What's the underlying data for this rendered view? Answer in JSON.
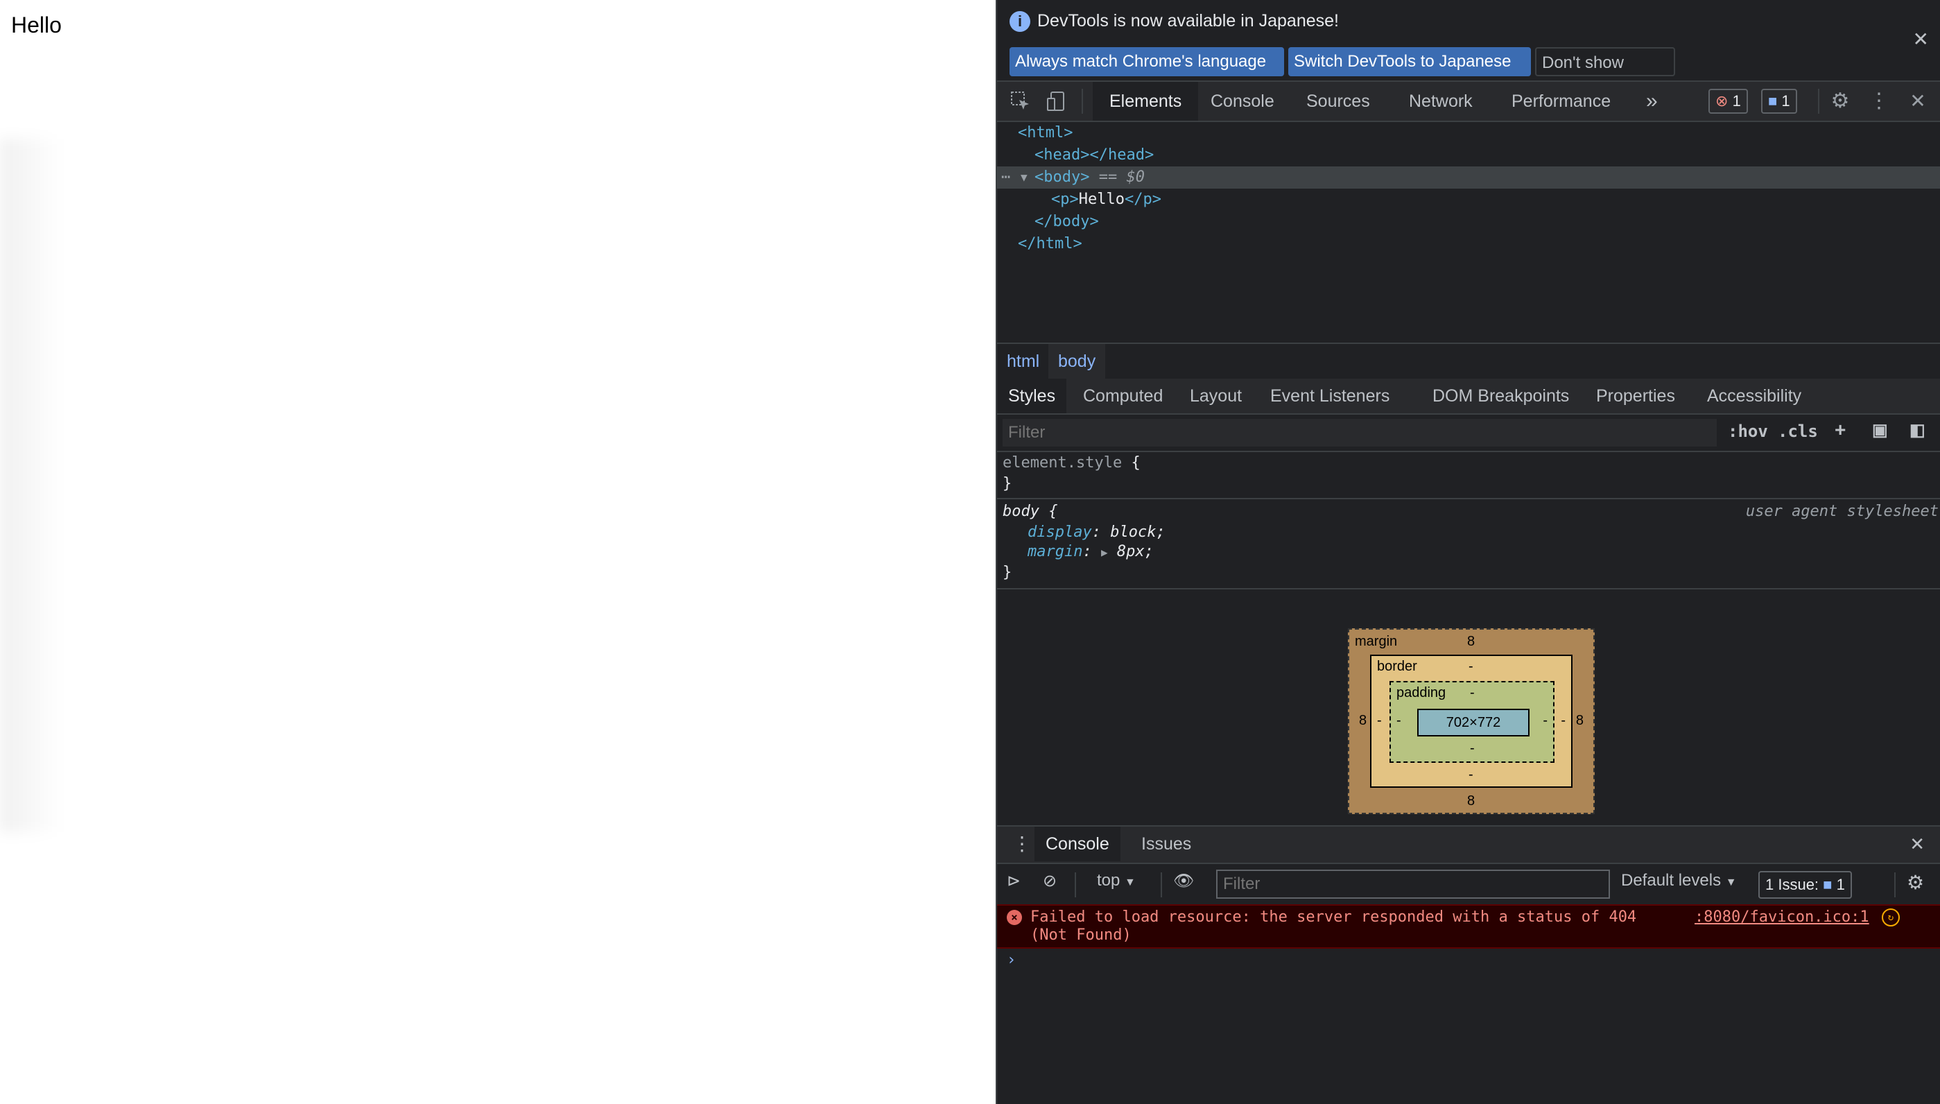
{
  "page": {
    "text": "Hello"
  },
  "infobar": {
    "message": "DevTools is now available in Japanese!",
    "buttons": [
      "Always match Chrome's language",
      "Switch DevTools to Japanese",
      "Don't show again"
    ]
  },
  "toolbar": {
    "tabs": [
      "Elements",
      "Console",
      "Sources",
      "Network",
      "Performance"
    ],
    "more": "»",
    "error_count": "1",
    "message_count": "1"
  },
  "tree": {
    "html_open": "<html>",
    "head": "<head></head>",
    "body_open": "<body>",
    "body_eq": "== $0",
    "p_open": "<p>",
    "p_text": "Hello",
    "p_close": "</p>",
    "body_close": "</body>",
    "html_close": "</html>"
  },
  "breadcrumbs": [
    "html",
    "body"
  ],
  "subtabs": [
    "Styles",
    "Computed",
    "Layout",
    "Event Listeners",
    "DOM Breakpoints",
    "Properties",
    "Accessibility"
  ],
  "styles": {
    "filter_placeholder": "Filter",
    "hov": ":hov",
    "cls": ".cls",
    "element_style_selector": "element.style",
    "open_brace": "{",
    "close_brace": "}",
    "body_selector": "body",
    "ua_label": "user agent stylesheet",
    "decl1_prop": "display",
    "decl1_val": "block;",
    "decl2_prop": "margin",
    "decl2_val": "8px;"
  },
  "box_model": {
    "margin_label": "margin",
    "border_label": "border",
    "padding_label": "padding",
    "margin": "8",
    "dash": "-",
    "content": "702×772"
  },
  "drawer": {
    "tabs": [
      "Console",
      "Issues"
    ],
    "context": "top",
    "filter_placeholder": "Filter",
    "levels": "Default levels",
    "issues_label": "1 Issue:",
    "issues_count": "1",
    "error_text": "Failed to load resource: the server responded with a status of 404 (Not Found)",
    "error_source": ":8080/favicon.ico:1",
    "prompt": "›"
  },
  "colors": {
    "panel_bg": "#202124",
    "accent_button": "#3b6cb2",
    "tag_blue": "#5db0d7",
    "error_red": "#f28b82"
  }
}
